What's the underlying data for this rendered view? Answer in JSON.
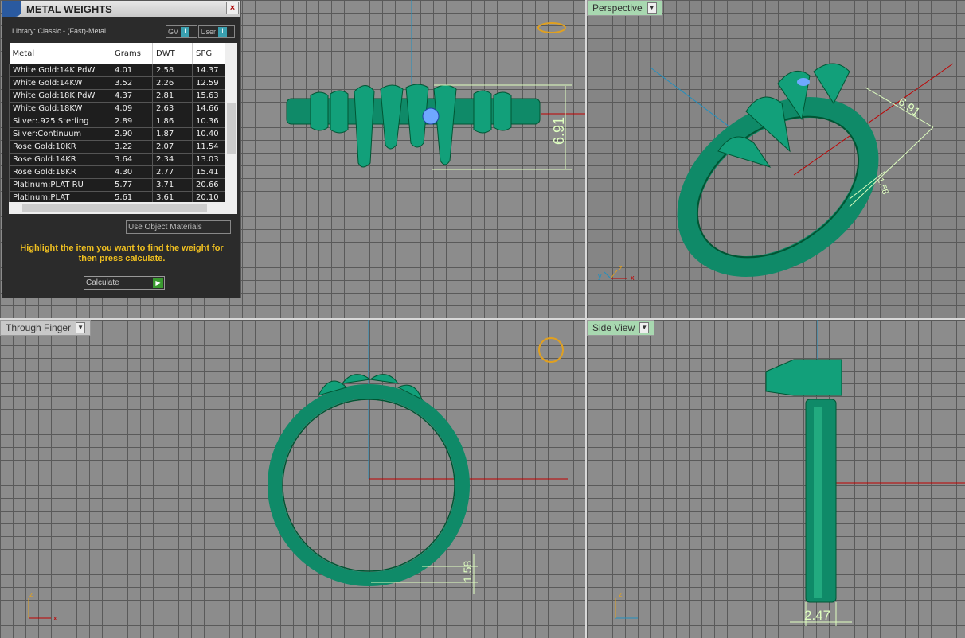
{
  "panel": {
    "title": "METAL WEIGHTS",
    "close": "×",
    "library": "Library: Classic - (Fast)-Metal",
    "gv": "GV",
    "user": "User",
    "toggle_mark": "I",
    "columns": [
      "Metal",
      "Grams",
      "DWT",
      "SPG"
    ],
    "rows": [
      [
        "White Gold:14K PdW",
        "4.01",
        "2.58",
        "14.37"
      ],
      [
        "White Gold:14KW",
        "3.52",
        "2.26",
        "12.59"
      ],
      [
        "White Gold:18K PdW",
        "4.37",
        "2.81",
        "15.63"
      ],
      [
        "White Gold:18KW",
        "4.09",
        "2.63",
        "14.66"
      ],
      [
        "Silver:.925 Sterling",
        "2.89",
        "1.86",
        "10.36"
      ],
      [
        "Silver:Continuum",
        "2.90",
        "1.87",
        "10.40"
      ],
      [
        "Rose Gold:10KR",
        "3.22",
        "2.07",
        "11.54"
      ],
      [
        "Rose Gold:14KR",
        "3.64",
        "2.34",
        "13.03"
      ],
      [
        "Rose Gold:18KR",
        "4.30",
        "2.77",
        "15.41"
      ],
      [
        "Platinum:PLAT RU",
        "5.77",
        "3.71",
        "20.66"
      ],
      [
        "Platinum:PLAT",
        "5.61",
        "3.61",
        "20.10"
      ]
    ],
    "use_object_materials": "Use Object Materials",
    "message": "Highlight the item you want to find the weight for then press calculate.",
    "calculate": "Calculate"
  },
  "viewports": {
    "perspective": "Perspective",
    "through_finger": "Through Finger",
    "side_view": "Side View"
  },
  "dimensions": {
    "front_height": "6.91",
    "persp_height": "6.91",
    "persp_thickness": "1.58",
    "finger_thickness": "1.58",
    "side_width": "2.47"
  },
  "axes": {
    "z": "z",
    "x": "x",
    "y": "y"
  },
  "colors": {
    "ring": "#0f8a68",
    "dimension": "#dfffc0",
    "x_axis": "#c00000",
    "z_axis": "#2090c0"
  }
}
